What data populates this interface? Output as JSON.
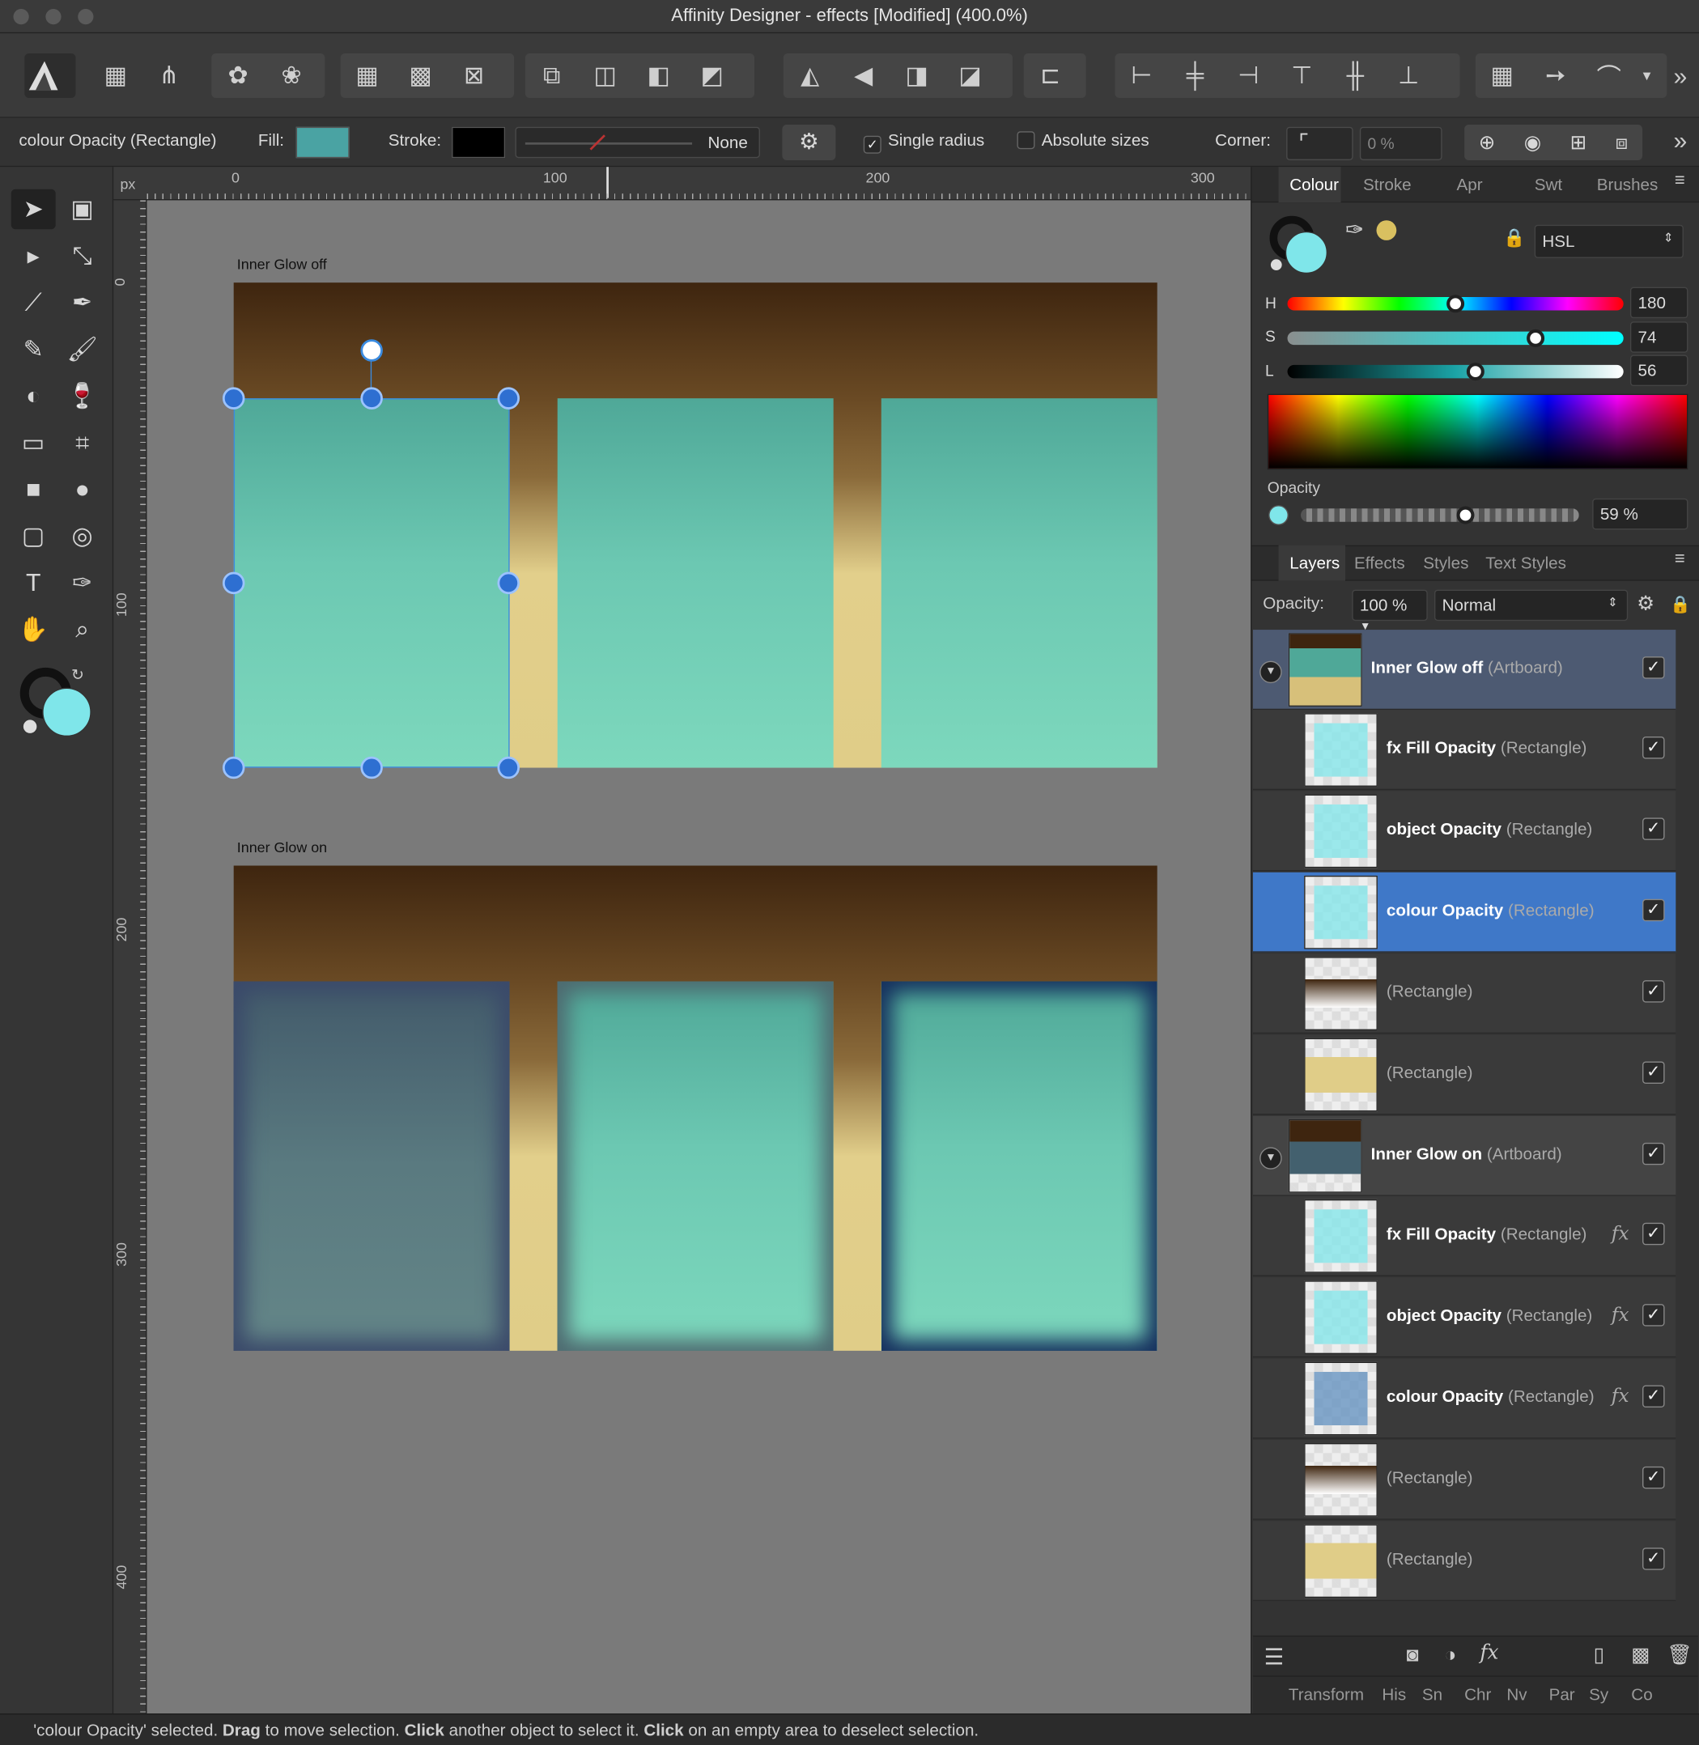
{
  "window": {
    "title": "Affinity Designer - effects [Modified] (400.0%)"
  },
  "context": {
    "selection": "colour Opacity (Rectangle)",
    "fill_label": "Fill:",
    "fill_color": "#4aa3a3",
    "stroke_label": "Stroke:",
    "stroke_color": "#000000",
    "stroke_value": "None",
    "single_radius": "Single radius",
    "absolute_sizes": "Absolute sizes",
    "corner_label": "Corner:",
    "corner_value": "0 %"
  },
  "ruler": {
    "unit": "px",
    "h_ticks": [
      "0",
      "100",
      "200",
      "300"
    ],
    "v_ticks": [
      "0",
      "100",
      "200",
      "300",
      "400"
    ]
  },
  "canvas": {
    "artboard1": "Inner Glow off",
    "artboard2": "Inner Glow on"
  },
  "colour_panel": {
    "tabs": [
      "Colour",
      "Stroke",
      "Apr",
      "Swt",
      "Brushes"
    ],
    "model": "HSL",
    "h_label": "H",
    "h_value": "180",
    "s_label": "S",
    "s_value": "74",
    "l_label": "L",
    "l_value": "56",
    "opacity_label": "Opacity",
    "opacity_value": "59 %",
    "current_color": "#7fe6ea"
  },
  "layers_panel": {
    "tabs": [
      "Layers",
      "Effects",
      "Styles",
      "Text Styles"
    ],
    "opacity_label": "Opacity:",
    "opacity_value": "100 %",
    "blend": "Normal",
    "rows": [
      {
        "name": "Inner Glow off",
        "type": "(Artboard)",
        "fx": ""
      },
      {
        "name": "fx Fill Opacity",
        "type": "(Rectangle)",
        "fx": ""
      },
      {
        "name": "object Opacity",
        "type": "(Rectangle)",
        "fx": ""
      },
      {
        "name": "colour Opacity",
        "type": "(Rectangle)",
        "fx": ""
      },
      {
        "name": "",
        "type": "(Rectangle)",
        "fx": ""
      },
      {
        "name": "",
        "type": "(Rectangle)",
        "fx": ""
      },
      {
        "name": "Inner Glow on",
        "type": "(Artboard)",
        "fx": ""
      },
      {
        "name": "fx Fill Opacity",
        "type": "(Rectangle)",
        "fx": "fx"
      },
      {
        "name": "object Opacity",
        "type": "(Rectangle)",
        "fx": "fx"
      },
      {
        "name": "colour Opacity",
        "type": "(Rectangle)",
        "fx": "fx"
      },
      {
        "name": "",
        "type": "(Rectangle)",
        "fx": ""
      },
      {
        "name": "",
        "type": "(Rectangle)",
        "fx": ""
      }
    ],
    "check": "✓"
  },
  "bottom_tabs": [
    "Transform",
    "His",
    "Sn",
    "Chr",
    "Nv",
    "Par",
    "Sy",
    "Co"
  ],
  "status": {
    "p1": "'colour Opacity' selected. ",
    "b1": "Drag",
    "p2": " to move selection. ",
    "b2": "Click",
    "p3": " another object to select it. ",
    "b3": "Click",
    "p4": " on an empty area to deselect selection."
  }
}
